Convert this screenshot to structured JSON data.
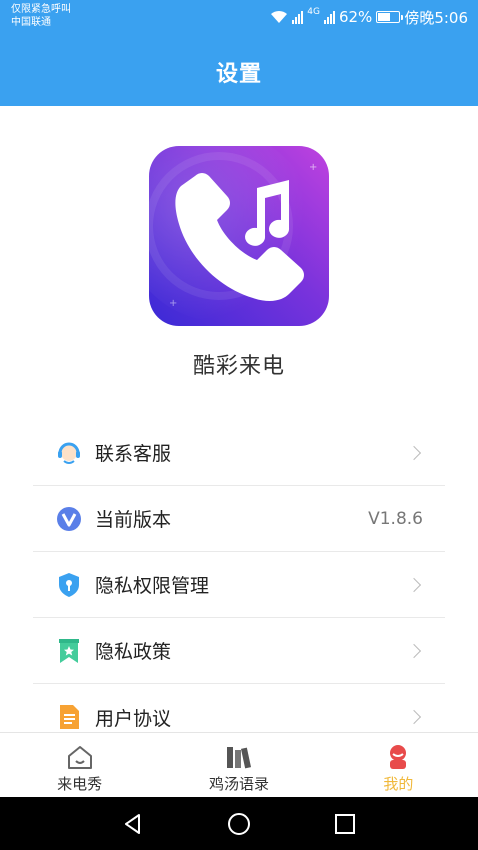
{
  "status_bar": {
    "carrier_line1": "仅限紧急呼叫",
    "carrier_line2": "中国联通",
    "network": "4G",
    "battery": "62%",
    "time": "傍晚5:06"
  },
  "header": {
    "title": "设置"
  },
  "app": {
    "name": "酷彩来电",
    "logo_icon": "phone-music-icon"
  },
  "menu": [
    {
      "label": "联系客服",
      "icon": "customer-service-icon",
      "right": "",
      "chevron": true
    },
    {
      "label": "当前版本",
      "icon": "version-icon",
      "right": "V1.8.6",
      "chevron": false
    },
    {
      "label": "隐私权限管理",
      "icon": "shield-lock-icon",
      "right": "",
      "chevron": true
    },
    {
      "label": "隐私政策",
      "icon": "bookmark-star-icon",
      "right": "",
      "chevron": true
    },
    {
      "label": "用户协议",
      "icon": "document-icon",
      "right": "",
      "chevron": true
    }
  ],
  "tabs": [
    {
      "label": "来电秀",
      "icon": "home-icon",
      "active": false
    },
    {
      "label": "鸡汤语录",
      "icon": "books-icon",
      "active": false
    },
    {
      "label": "我的",
      "icon": "profile-icon",
      "active": true
    }
  ],
  "colors": {
    "header": "#3aa1f0",
    "active_tab": "#f0b83a",
    "logo_gradient": [
      "#3b2bd8",
      "#b23fe0"
    ]
  }
}
